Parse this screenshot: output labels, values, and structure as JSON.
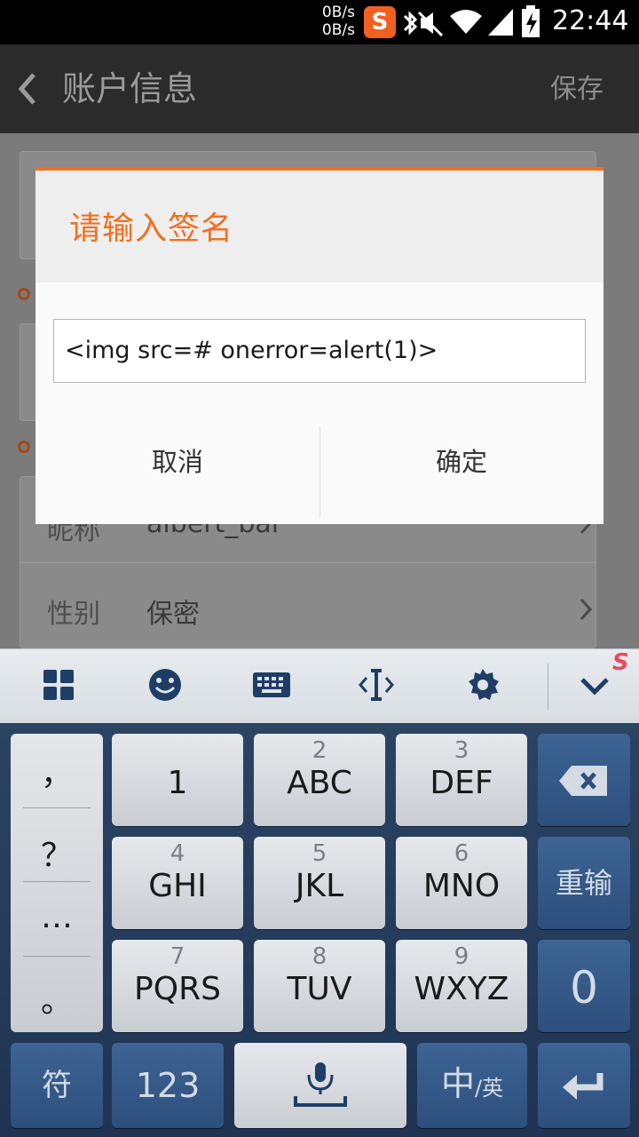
{
  "status_bar": {
    "net_up": "0B/s",
    "net_down": "0B/s",
    "ime_badge": "S",
    "time": "22:44",
    "icons": [
      "sogou-ime-icon",
      "bluetooth-icon",
      "mute-icon",
      "wifi-icon",
      "signal-icon",
      "battery-icon"
    ]
  },
  "app_bar": {
    "title": "账户信息",
    "save_label": "保存",
    "back_icon": "chevron-left-icon"
  },
  "background_page": {
    "rows": [
      {
        "label": "昵称",
        "value": "albert_bai"
      },
      {
        "label": "性别",
        "value": "保密"
      }
    ]
  },
  "dialog": {
    "title": "请输入签名",
    "input_value": "<img src=# onerror=alert(1)>",
    "cancel_label": "取消",
    "confirm_label": "确定",
    "accent_color": "#f0701f"
  },
  "keyboard": {
    "toolbar_icons": [
      "grid-menu-icon",
      "emoji-icon",
      "keyboard-icon",
      "cursor-icon",
      "settings-icon",
      "collapse-icon"
    ],
    "punctuation": [
      "，",
      "？",
      "…",
      "。"
    ],
    "keys": {
      "k1": {
        "num": "",
        "main": "1"
      },
      "k2": {
        "num": "2",
        "main": "ABC"
      },
      "k3": {
        "num": "3",
        "main": "DEF"
      },
      "k4": {
        "num": "4",
        "main": "GHI"
      },
      "k5": {
        "num": "5",
        "main": "JKL"
      },
      "k6": {
        "num": "6",
        "main": "MNO"
      },
      "k7": {
        "num": "7",
        "main": "PQRS"
      },
      "k8": {
        "num": "8",
        "main": "TUV"
      },
      "k9": {
        "num": "9",
        "main": "WXYZ"
      }
    },
    "reenter_label": "重输",
    "zero_label": "0",
    "symbol_label": "符",
    "num_label": "123",
    "lang_main": "中",
    "lang_sub": "/英"
  }
}
